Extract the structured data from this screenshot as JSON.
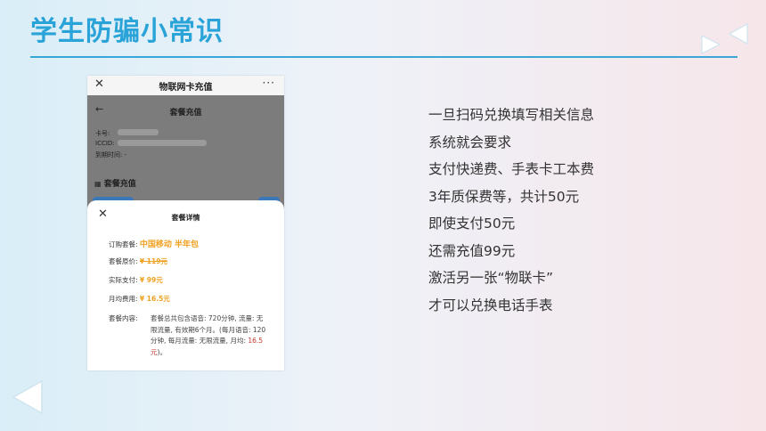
{
  "slide": {
    "title": "学生防骗小常识"
  },
  "phone": {
    "title": "物联网卡充值",
    "menu": "···",
    "page_title": "套餐充值",
    "card_label": "卡号:",
    "iccid_label": "ICCID:",
    "expire_label": "到期时间: -",
    "section_title": "套餐充值"
  },
  "sheet": {
    "title": "套餐详情",
    "rows": [
      {
        "label": "订购套餐:",
        "value": "中国移动 半年包"
      },
      {
        "label": "套餐原价:",
        "value": "¥ 119元"
      },
      {
        "label": "实际支付:",
        "value": "¥ 99元"
      },
      {
        "label": "月均费用:",
        "value": "¥ 16.5元"
      }
    ],
    "content_label": "套餐内容:",
    "content_text": "套餐总共包含语音: 720分钟, 流量: 无限流量, 有效期6个月。(每月语音: 120分钟, 每月流量: 无限流量, 月均:",
    "content_price": "16.5元",
    "content_end": ")。"
  },
  "lines": [
    "一旦扫码兑换填写相关信息",
    "系统就会要求",
    "支付快递费、手表卡工本费",
    "3年质保费等，共计50元",
    "即使支付50元",
    "还需充值99元",
    "激活另一张“物联卡”",
    "才可以兑换电话手表"
  ]
}
